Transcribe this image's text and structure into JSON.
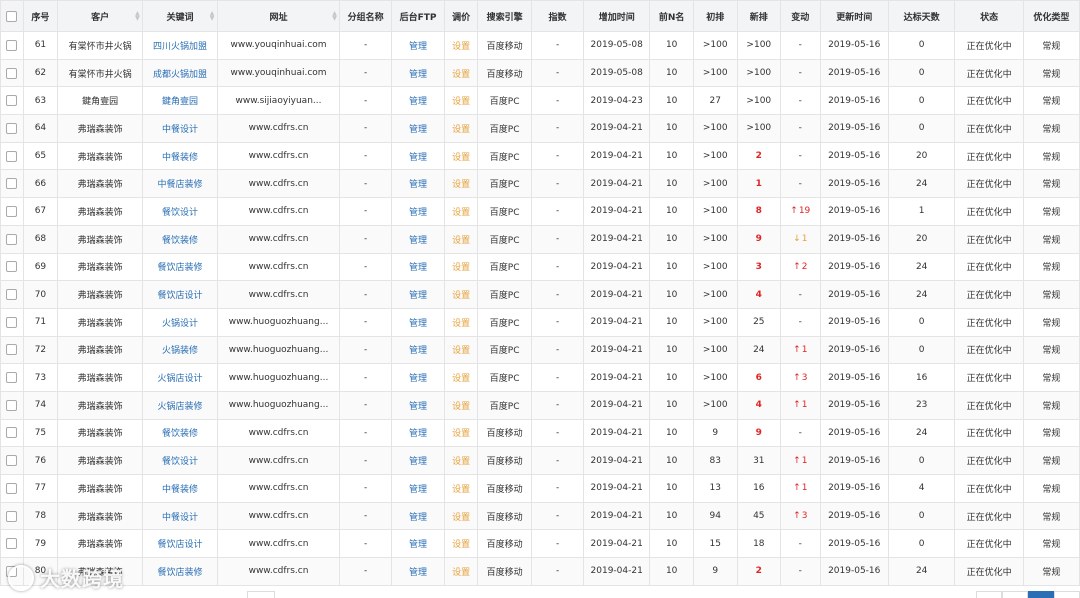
{
  "headers": [
    "序号",
    "客户",
    "关键词",
    "网址",
    "分组名称",
    "后台FTP",
    "调价",
    "搜索引擎",
    "指数",
    "增加时间",
    "前N名",
    "初排",
    "新排",
    "变动",
    "更新时间",
    "达标天数",
    "状态",
    "优化类型"
  ],
  "rows": [
    {
      "id": "61",
      "client": "有棠怀市井火锅",
      "keyword": "四川火锅加盟",
      "url": "www.youqinhuai.com",
      "group": "-",
      "ftp": "管理",
      "price": "设置",
      "engine": "百度移动",
      "index": "-",
      "added": "2019-05-08",
      "topn": "10",
      "initial": ">100",
      "new": ">100",
      "new_red": false,
      "change": "-",
      "change_dir": "",
      "updated": "2019-05-16",
      "days": "0",
      "status": "正在优化中",
      "type": "常规"
    },
    {
      "id": "62",
      "client": "有棠怀市井火锅",
      "keyword": "成都火锅加盟",
      "url": "www.youqinhuai.com",
      "group": "-",
      "ftp": "管理",
      "price": "设置",
      "engine": "百度移动",
      "index": "-",
      "added": "2019-05-08",
      "topn": "10",
      "initial": ">100",
      "new": ">100",
      "new_red": false,
      "change": "-",
      "change_dir": "",
      "updated": "2019-05-16",
      "days": "0",
      "status": "正在优化中",
      "type": "常规"
    },
    {
      "id": "63",
      "client": "鍵角壹园",
      "keyword": "鍵角壹园",
      "url": "www.sijiaoyiyuan...",
      "group": "-",
      "ftp": "管理",
      "price": "设置",
      "engine": "百度PC",
      "index": "-",
      "added": "2019-04-23",
      "topn": "10",
      "initial": "27",
      "new": ">100",
      "new_red": false,
      "change": "-",
      "change_dir": "",
      "updated": "2019-05-16",
      "days": "0",
      "status": "正在优化中",
      "type": "常规"
    },
    {
      "id": "64",
      "client": "弗瑞森装饰",
      "keyword": "中餐设计",
      "url": "www.cdfrs.cn",
      "group": "-",
      "ftp": "管理",
      "price": "设置",
      "engine": "百度PC",
      "index": "-",
      "added": "2019-04-21",
      "topn": "10",
      "initial": ">100",
      "new": ">100",
      "new_red": false,
      "change": "-",
      "change_dir": "",
      "updated": "2019-05-16",
      "days": "0",
      "status": "正在优化中",
      "type": "常规"
    },
    {
      "id": "65",
      "client": "弗瑞森装饰",
      "keyword": "中餐装修",
      "url": "www.cdfrs.cn",
      "group": "-",
      "ftp": "管理",
      "price": "设置",
      "engine": "百度PC",
      "index": "-",
      "added": "2019-04-21",
      "topn": "10",
      "initial": ">100",
      "new": "2",
      "new_red": true,
      "change": "-",
      "change_dir": "",
      "updated": "2019-05-16",
      "days": "20",
      "status": "正在优化中",
      "type": "常规"
    },
    {
      "id": "66",
      "client": "弗瑞森装饰",
      "keyword": "中餐店装修",
      "url": "www.cdfrs.cn",
      "group": "-",
      "ftp": "管理",
      "price": "设置",
      "engine": "百度PC",
      "index": "-",
      "added": "2019-04-21",
      "topn": "10",
      "initial": ">100",
      "new": "1",
      "new_red": true,
      "change": "-",
      "change_dir": "",
      "updated": "2019-05-16",
      "days": "24",
      "status": "正在优化中",
      "type": "常规"
    },
    {
      "id": "67",
      "client": "弗瑞森装饰",
      "keyword": "餐饮设计",
      "url": "www.cdfrs.cn",
      "group": "-",
      "ftp": "管理",
      "price": "设置",
      "engine": "百度PC",
      "index": "-",
      "added": "2019-04-21",
      "topn": "10",
      "initial": ">100",
      "new": "8",
      "new_red": true,
      "change": "19",
      "change_dir": "up",
      "updated": "2019-05-16",
      "days": "1",
      "status": "正在优化中",
      "type": "常规"
    },
    {
      "id": "68",
      "client": "弗瑞森装饰",
      "keyword": "餐饮装修",
      "url": "www.cdfrs.cn",
      "group": "-",
      "ftp": "管理",
      "price": "设置",
      "engine": "百度PC",
      "index": "-",
      "added": "2019-04-21",
      "topn": "10",
      "initial": ">100",
      "new": "9",
      "new_red": true,
      "change": "1",
      "change_dir": "down",
      "updated": "2019-05-16",
      "days": "20",
      "status": "正在优化中",
      "type": "常规"
    },
    {
      "id": "69",
      "client": "弗瑞森装饰",
      "keyword": "餐饮店装修",
      "url": "www.cdfrs.cn",
      "group": "-",
      "ftp": "管理",
      "price": "设置",
      "engine": "百度PC",
      "index": "-",
      "added": "2019-04-21",
      "topn": "10",
      "initial": ">100",
      "new": "3",
      "new_red": true,
      "change": "2",
      "change_dir": "up",
      "updated": "2019-05-16",
      "days": "24",
      "status": "正在优化中",
      "type": "常规"
    },
    {
      "id": "70",
      "client": "弗瑞森装饰",
      "keyword": "餐饮店设计",
      "url": "www.cdfrs.cn",
      "group": "-",
      "ftp": "管理",
      "price": "设置",
      "engine": "百度PC",
      "index": "-",
      "added": "2019-04-21",
      "topn": "10",
      "initial": ">100",
      "new": "4",
      "new_red": true,
      "change": "-",
      "change_dir": "",
      "updated": "2019-05-16",
      "days": "24",
      "status": "正在优化中",
      "type": "常规"
    },
    {
      "id": "71",
      "client": "弗瑞森装饰",
      "keyword": "火锅设计",
      "url": "www.huoguozhuang...",
      "group": "-",
      "ftp": "管理",
      "price": "设置",
      "engine": "百度PC",
      "index": "-",
      "added": "2019-04-21",
      "topn": "10",
      "initial": ">100",
      "new": "25",
      "new_red": false,
      "change": "-",
      "change_dir": "",
      "updated": "2019-05-16",
      "days": "0",
      "status": "正在优化中",
      "type": "常规"
    },
    {
      "id": "72",
      "client": "弗瑞森装饰",
      "keyword": "火锅装修",
      "url": "www.huoguozhuang...",
      "group": "-",
      "ftp": "管理",
      "price": "设置",
      "engine": "百度PC",
      "index": "-",
      "added": "2019-04-21",
      "topn": "10",
      "initial": ">100",
      "new": "24",
      "new_red": false,
      "change": "1",
      "change_dir": "up",
      "updated": "2019-05-16",
      "days": "0",
      "status": "正在优化中",
      "type": "常规"
    },
    {
      "id": "73",
      "client": "弗瑞森装饰",
      "keyword": "火锅店设计",
      "url": "www.huoguozhuang...",
      "group": "-",
      "ftp": "管理",
      "price": "设置",
      "engine": "百度PC",
      "index": "-",
      "added": "2019-04-21",
      "topn": "10",
      "initial": ">100",
      "new": "6",
      "new_red": true,
      "change": "3",
      "change_dir": "up",
      "updated": "2019-05-16",
      "days": "16",
      "status": "正在优化中",
      "type": "常规"
    },
    {
      "id": "74",
      "client": "弗瑞森装饰",
      "keyword": "火锅店装修",
      "url": "www.huoguozhuang...",
      "group": "-",
      "ftp": "管理",
      "price": "设置",
      "engine": "百度PC",
      "index": "-",
      "added": "2019-04-21",
      "topn": "10",
      "initial": ">100",
      "new": "4",
      "new_red": true,
      "change": "1",
      "change_dir": "up",
      "updated": "2019-05-16",
      "days": "23",
      "status": "正在优化中",
      "type": "常规"
    },
    {
      "id": "75",
      "client": "弗瑞森装饰",
      "keyword": "餐饮装修",
      "url": "www.cdfrs.cn",
      "group": "-",
      "ftp": "管理",
      "price": "设置",
      "engine": "百度移动",
      "index": "-",
      "added": "2019-04-21",
      "topn": "10",
      "initial": "9",
      "new": "9",
      "new_red": true,
      "change": "-",
      "change_dir": "",
      "updated": "2019-05-16",
      "days": "24",
      "status": "正在优化中",
      "type": "常规"
    },
    {
      "id": "76",
      "client": "弗瑞森装饰",
      "keyword": "餐饮设计",
      "url": "www.cdfrs.cn",
      "group": "-",
      "ftp": "管理",
      "price": "设置",
      "engine": "百度移动",
      "index": "-",
      "added": "2019-04-21",
      "topn": "10",
      "initial": "83",
      "new": "31",
      "new_red": false,
      "change": "1",
      "change_dir": "up",
      "updated": "2019-05-16",
      "days": "0",
      "status": "正在优化中",
      "type": "常规"
    },
    {
      "id": "77",
      "client": "弗瑞森装饰",
      "keyword": "中餐装修",
      "url": "www.cdfrs.cn",
      "group": "-",
      "ftp": "管理",
      "price": "设置",
      "engine": "百度移动",
      "index": "-",
      "added": "2019-04-21",
      "topn": "10",
      "initial": "13",
      "new": "16",
      "new_red": false,
      "change": "1",
      "change_dir": "up",
      "updated": "2019-05-16",
      "days": "4",
      "status": "正在优化中",
      "type": "常规"
    },
    {
      "id": "78",
      "client": "弗瑞森装饰",
      "keyword": "中餐设计",
      "url": "www.cdfrs.cn",
      "group": "-",
      "ftp": "管理",
      "price": "设置",
      "engine": "百度移动",
      "index": "-",
      "added": "2019-04-21",
      "topn": "10",
      "initial": "94",
      "new": "45",
      "new_red": false,
      "change": "3",
      "change_dir": "up",
      "updated": "2019-05-16",
      "days": "0",
      "status": "正在优化中",
      "type": "常规"
    },
    {
      "id": "79",
      "client": "弗瑞森装饰",
      "keyword": "餐饮店设计",
      "url": "www.cdfrs.cn",
      "group": "-",
      "ftp": "管理",
      "price": "设置",
      "engine": "百度移动",
      "index": "-",
      "added": "2019-04-21",
      "topn": "10",
      "initial": "15",
      "new": "18",
      "new_red": false,
      "change": "-",
      "change_dir": "",
      "updated": "2019-05-16",
      "days": "0",
      "status": "正在优化中",
      "type": "常规"
    },
    {
      "id": "80",
      "client": "弗瑞森装饰",
      "keyword": "餐饮店装修",
      "url": "www.cdfrs.cn",
      "group": "-",
      "ftp": "管理",
      "price": "设置",
      "engine": "百度移动",
      "index": "-",
      "added": "2019-04-21",
      "topn": "10",
      "initial": "9",
      "new": "2",
      "new_red": true,
      "change": "-",
      "change_dir": "",
      "updated": "2019-05-16",
      "days": "24",
      "status": "正在优化中",
      "type": "常规"
    }
  ],
  "watermark": "大数跨境",
  "colors": {
    "link": "#2a6fb5",
    "setting": "#e6a23c",
    "red": "#e02424",
    "header_bg": "#f3f4f6",
    "pager_active": "#2a6fb5"
  }
}
